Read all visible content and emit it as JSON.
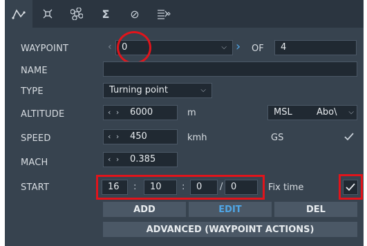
{
  "tabs": [
    {
      "icon": "route-icon"
    },
    {
      "icon": "target-frame-icon"
    },
    {
      "icon": "command-icon"
    },
    {
      "icon": "sigma-icon",
      "glyph": "Σ"
    },
    {
      "icon": "disabled-icon",
      "glyph": "⊘"
    },
    {
      "icon": "list-diamond-icon"
    }
  ],
  "waypoint": {
    "label": "WAYPOINT",
    "value": "0",
    "of_label": "OF",
    "total": "4"
  },
  "name": {
    "label": "NAME",
    "value": ""
  },
  "type": {
    "label": "TYPE",
    "value": "Turning point"
  },
  "altitude": {
    "label": "ALTITUDE",
    "value": "6000",
    "unit": "m",
    "reference": "MSL",
    "reference2": "Abo\\"
  },
  "speed": {
    "label": "SPEED",
    "value": "450",
    "unit": "kmh",
    "mode": "GS"
  },
  "mach": {
    "label": "MACH",
    "value": "0.385"
  },
  "start": {
    "label": "START",
    "hours": "16",
    "minutes": "10",
    "seconds": "0",
    "day": "0",
    "fix_time_label": "Fix time",
    "fix_time_checked": true
  },
  "buttons": {
    "add": "ADD",
    "edit": "EDIT",
    "del": "DEL",
    "advanced": "ADVANCED (WAYPOINT ACTIONS)"
  },
  "colors": {
    "panel": "#37434f",
    "field": "#202932",
    "accent": "#4fa6e6",
    "highlight": "#e1141b"
  }
}
